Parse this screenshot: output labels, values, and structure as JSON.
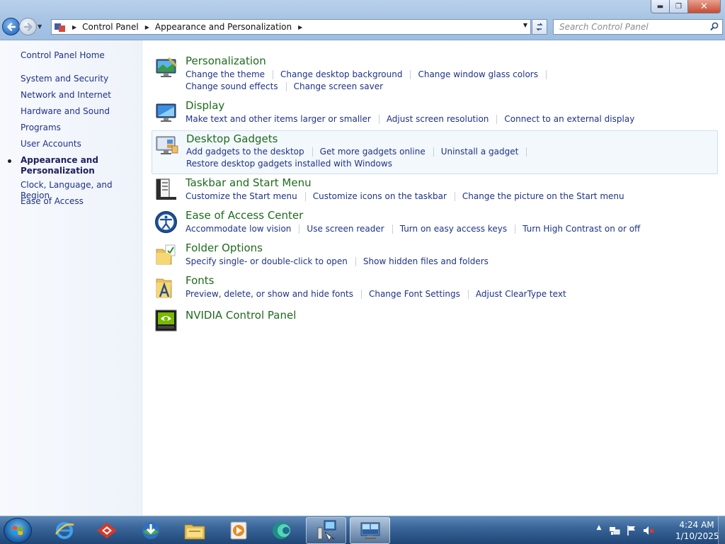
{
  "window": {
    "controls": {
      "minimize": "▬",
      "maximize": "❐",
      "close": "✕"
    }
  },
  "address": {
    "breadcrumb": [
      "Control Panel",
      "Appearance and Personalization"
    ],
    "search_placeholder": "Search Control Panel"
  },
  "sidebar": {
    "home": "Control Panel Home",
    "items": [
      {
        "label": "System and Security"
      },
      {
        "label": "Network and Internet"
      },
      {
        "label": "Hardware and Sound"
      },
      {
        "label": "Programs"
      },
      {
        "label": "User Accounts"
      },
      {
        "label": "Appearance and Personalization",
        "active": true
      },
      {
        "label": "Clock, Language, and Region"
      },
      {
        "label": "Ease of Access"
      }
    ]
  },
  "categories": [
    {
      "title": "Personalization",
      "icon": "personalization-icon",
      "link_rows": [
        [
          "Change the theme",
          "Change desktop background",
          "Change window glass colors"
        ],
        [
          "Change sound effects",
          "Change screen saver"
        ]
      ]
    },
    {
      "title": "Display",
      "icon": "display-icon",
      "link_rows": [
        [
          "Make text and other items larger or smaller",
          "Adjust screen resolution",
          "Connect to an external display"
        ]
      ]
    },
    {
      "title": "Desktop Gadgets",
      "icon": "gadgets-icon",
      "link_rows": [
        [
          "Add gadgets to the desktop",
          "Get more gadgets online",
          "Uninstall a gadget"
        ],
        [
          "Restore desktop gadgets installed with Windows"
        ]
      ]
    },
    {
      "title": "Taskbar and Start Menu",
      "icon": "taskbar-icon",
      "link_rows": [
        [
          "Customize the Start menu",
          "Customize icons on the taskbar",
          "Change the picture on the Start menu"
        ]
      ]
    },
    {
      "title": "Ease of Access Center",
      "icon": "ease-of-access-icon",
      "link_rows": [
        [
          "Accommodate low vision",
          "Use screen reader",
          "Turn on easy access keys",
          "Turn High Contrast on or off"
        ]
      ]
    },
    {
      "title": "Folder Options",
      "icon": "folder-options-icon",
      "link_rows": [
        [
          "Specify single- or double-click to open",
          "Show hidden files and folders"
        ]
      ]
    },
    {
      "title": "Fonts",
      "icon": "fonts-icon",
      "link_rows": [
        [
          "Preview, delete, or show and hide fonts",
          "Change Font Settings",
          "Adjust ClearType text"
        ]
      ]
    },
    {
      "title": "NVIDIA Control Panel",
      "icon": "nvidia-icon",
      "link_rows": []
    }
  ],
  "taskbar": {
    "pinned": [
      "internet-explorer-icon",
      "red-app-icon",
      "download-manager-icon",
      "file-explorer-icon",
      "media-player-icon",
      "teal-app-icon",
      "control-panel-app-icon",
      "remote-desktop-icon"
    ],
    "clock_time": "4:24 AM",
    "clock_date": "1/10/2025"
  },
  "colors": {
    "link": "#1e3287",
    "category_title": "#1e6b1e",
    "sidebar_bg": "#eef3fa",
    "taskbar": "#2f5a8c"
  }
}
